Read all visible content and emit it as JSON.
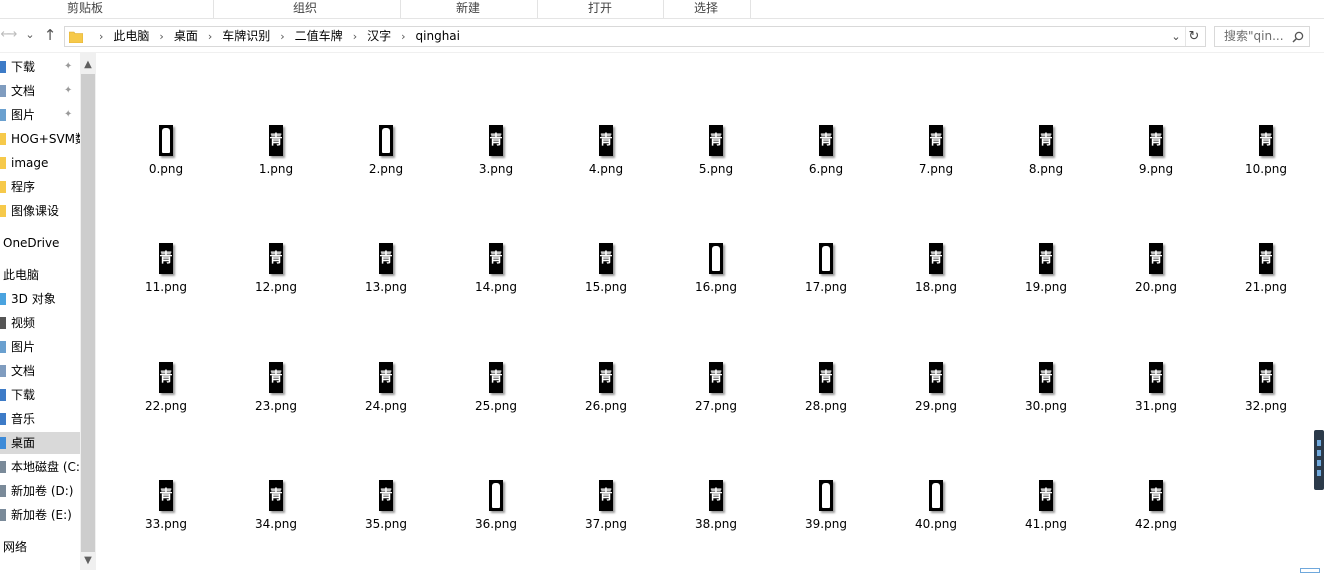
{
  "ribbon": {
    "groups": [
      "剪贴板",
      "组织",
      "新建",
      "打开",
      "选择"
    ]
  },
  "nav": {
    "back": "←",
    "forward": "→",
    "recent": "⌄",
    "up": "↑",
    "breadcrumbs": [
      "此电脑",
      "桌面",
      "车牌识别",
      "二值车牌",
      "汉字",
      "qinghai"
    ],
    "crumb_separator": "›",
    "dropdown": "⌄",
    "refresh": "↻",
    "search_placeholder": "搜索\"qin...",
    "search_icon": "search-icon"
  },
  "sidebar": {
    "items": [
      {
        "label": "下载",
        "icon": "download-icon",
        "pinned": true
      },
      {
        "label": "文档",
        "icon": "document-icon",
        "pinned": true
      },
      {
        "label": "图片",
        "icon": "picture-icon",
        "pinned": true
      },
      {
        "label": "HOG+SVM数",
        "icon": "folder-icon"
      },
      {
        "label": "image",
        "icon": "folder-icon"
      },
      {
        "label": "程序",
        "icon": "folder-icon"
      },
      {
        "label": "图像课设",
        "icon": "folder-icon"
      },
      {
        "label": "OneDrive",
        "icon": "cloud-icon"
      },
      {
        "label": "此电脑",
        "icon": "computer-icon"
      },
      {
        "label": "3D 对象",
        "icon": "cube-icon"
      },
      {
        "label": "视频",
        "icon": "video-icon"
      },
      {
        "label": "图片",
        "icon": "picture-icon"
      },
      {
        "label": "文档",
        "icon": "document-icon"
      },
      {
        "label": "下载",
        "icon": "download-icon"
      },
      {
        "label": "音乐",
        "icon": "music-icon"
      },
      {
        "label": "桌面",
        "icon": "desktop-icon",
        "selected": true
      },
      {
        "label": "本地磁盘 (C:",
        "icon": "drive-icon"
      },
      {
        "label": "新加卷 (D:)",
        "icon": "drive-icon"
      },
      {
        "label": "新加卷 (E:)",
        "icon": "drive-icon"
      },
      {
        "label": "网络",
        "icon": "network-icon"
      }
    ],
    "pin_glyph": "📌"
  },
  "files": {
    "thumbnail_glyph": "青",
    "items": [
      "0.png",
      "1.png",
      "2.png",
      "3.png",
      "4.png",
      "5.png",
      "6.png",
      "7.png",
      "8.png",
      "9.png",
      "10.png",
      "11.png",
      "12.png",
      "13.png",
      "14.png",
      "15.png",
      "16.png",
      "17.png",
      "18.png",
      "19.png",
      "20.png",
      "21.png",
      "22.png",
      "23.png",
      "24.png",
      "25.png",
      "26.png",
      "27.png",
      "28.png",
      "29.png",
      "30.png",
      "31.png",
      "32.png",
      "33.png",
      "34.png",
      "35.png",
      "36.png",
      "37.png",
      "38.png",
      "39.png",
      "40.png",
      "41.png",
      "42.png"
    ],
    "blob_indices": [
      0,
      2,
      16,
      17,
      36,
      39,
      40
    ]
  },
  "colors": {
    "accent": "#6fa8dc",
    "selection": "#d9d9d9",
    "folder": "#f6c94a"
  }
}
